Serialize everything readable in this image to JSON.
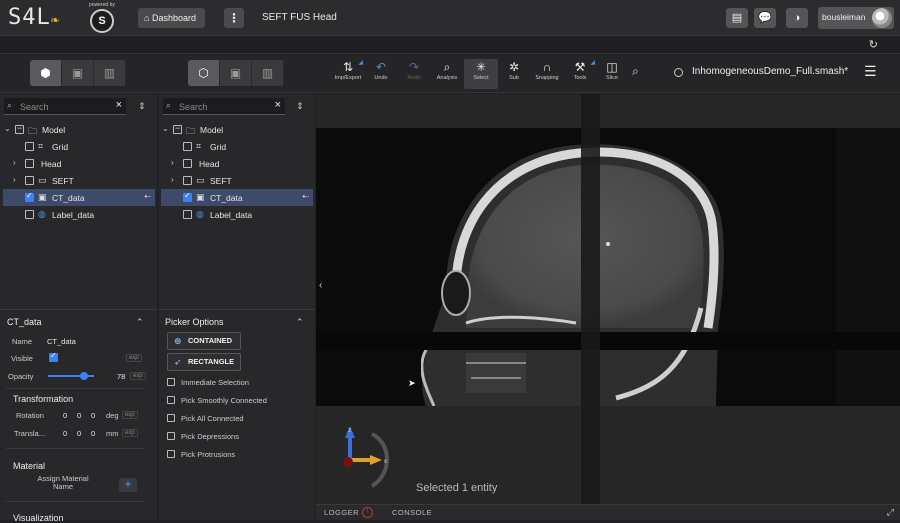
{
  "header": {
    "logo": "S4L",
    "powered_by": "powered by",
    "s2_logo": "S",
    "dashboard_label": "Dashboard",
    "title": "SEFT FUS Head",
    "username": "bousleiman"
  },
  "toolbar": {
    "tools": [
      {
        "name": "imp-export",
        "label": "Imp/Export",
        "icon": "import-export-icon",
        "glyph": "⇅"
      },
      {
        "name": "undo",
        "label": "Undo",
        "icon": "undo-icon",
        "glyph": "↶"
      },
      {
        "name": "redo",
        "label": "Redo",
        "icon": "redo-icon",
        "glyph": "↷"
      },
      {
        "name": "analysis",
        "label": "Analysis",
        "icon": "analysis-icon",
        "glyph": "⌕"
      },
      {
        "name": "select",
        "label": "Select",
        "icon": "select-icon",
        "glyph": "✳"
      },
      {
        "name": "sub",
        "label": "Sub",
        "icon": "sub-icon",
        "glyph": "✲"
      },
      {
        "name": "snapping",
        "label": "Snapping",
        "icon": "magnet-icon",
        "glyph": "∩"
      },
      {
        "name": "tools",
        "label": "Tools",
        "icon": "tools-icon",
        "glyph": "⚒"
      },
      {
        "name": "slice",
        "label": "Slice",
        "icon": "slice-icon",
        "glyph": "◫"
      }
    ],
    "file_name": "InhomogeneousDemo_Full.smash*"
  },
  "tree1": {
    "search_placeholder": "Search",
    "items": [
      {
        "label": "Model"
      },
      {
        "label": "Grid"
      },
      {
        "label": "Head"
      },
      {
        "label": "SEFT"
      },
      {
        "label": "CT_data"
      },
      {
        "label": "Label_data"
      }
    ]
  },
  "tree2": {
    "search_placeholder": "Search",
    "items": [
      {
        "label": "Model"
      },
      {
        "label": "Grid"
      },
      {
        "label": "Head"
      },
      {
        "label": "SEFT"
      },
      {
        "label": "CT_data"
      },
      {
        "label": "Label_data"
      }
    ]
  },
  "properties": {
    "title": "CT_data",
    "name_label": "Name",
    "name_value": "CT_data",
    "visible_label": "Visible",
    "opacity_label": "Opacity",
    "opacity_value": "78",
    "opacity_fraction": 0.78,
    "exp": "exp",
    "transformation_title": "Transformation",
    "rotation_label": "Rotation",
    "rotation_values": [
      "0",
      "0",
      "0"
    ],
    "rotation_unit": "deg",
    "translation_label": "Transla...",
    "translation_values": [
      "0",
      "0",
      "0"
    ],
    "translation_unit": "mm",
    "material_title": "Material",
    "assign_material_label": "Assign Material Name",
    "add_glyph": "+",
    "visualization_title": "Visualization"
  },
  "picker": {
    "title": "Picker Options",
    "contained_label": "CONTAINED",
    "rectangle_label": "RECTANGLE",
    "options": [
      {
        "label": "Immediate Selection"
      },
      {
        "label": "Pick Smoothly Connected"
      },
      {
        "label": "Pick All Connected"
      },
      {
        "label": "Pick Depressions"
      },
      {
        "label": "Pick Protrusions"
      }
    ]
  },
  "viewport": {
    "status": "Selected 1 entity",
    "gizmo_z": "z",
    "gizmo_x": "x"
  },
  "bottom": {
    "logger": "LOGGER",
    "logger_badge": "!",
    "console": "CONSOLE"
  }
}
